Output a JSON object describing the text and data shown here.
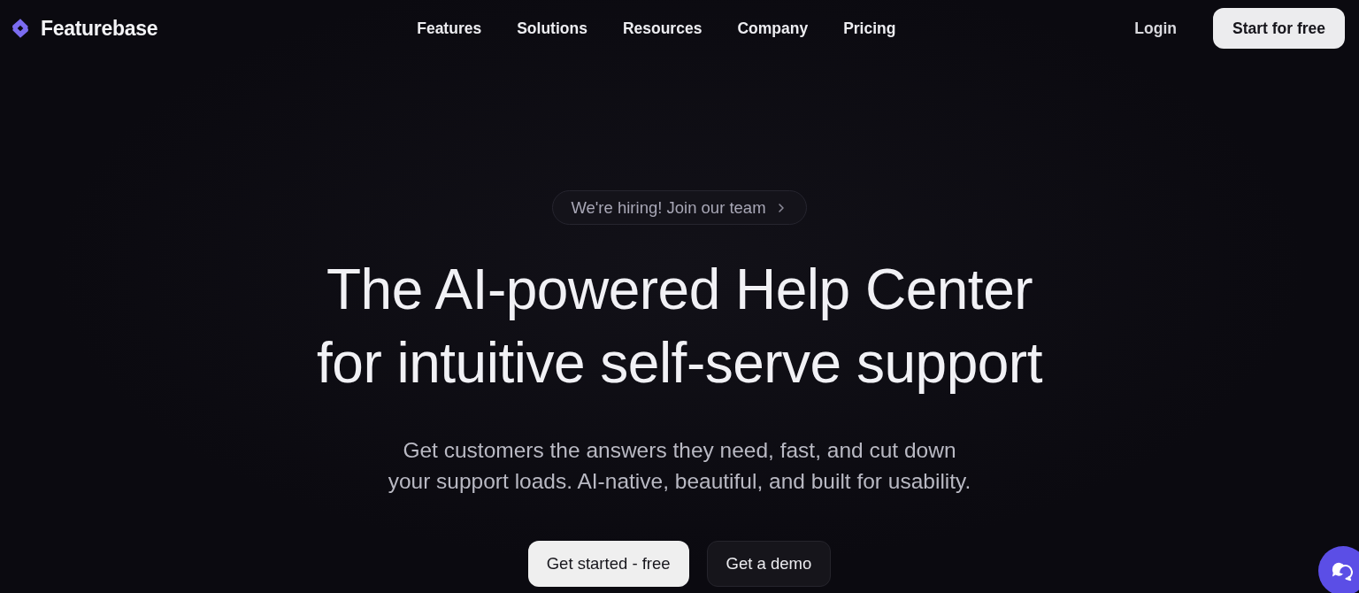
{
  "header": {
    "brand": "Featurebase",
    "nav": [
      "Features",
      "Solutions",
      "Resources",
      "Company",
      "Pricing"
    ],
    "login": "Login",
    "cta": "Start for free"
  },
  "hero": {
    "announcement": "We're hiring! Join our team",
    "heading_lines": [
      "The AI-powered Help Center",
      "for intuitive self-serve support"
    ],
    "subheading_lines": [
      "Get customers the answers they need, fast, and cut down",
      "your support loads. AI-native, beautiful, and built for usability."
    ],
    "buttons": [
      {
        "label": "Get started - free",
        "kind": "primary"
      },
      {
        "label": "Get a demo",
        "kind": "secondary"
      }
    ]
  }
}
